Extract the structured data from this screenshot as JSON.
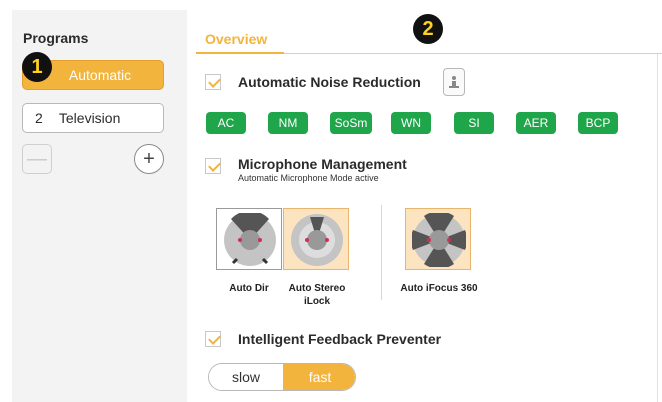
{
  "sidebar": {
    "title": "Programs",
    "programs": [
      {
        "number": "",
        "name": "Automatic",
        "active": true
      },
      {
        "number": "2",
        "name": "Television",
        "active": false
      }
    ],
    "remove_symbol": "—",
    "add_symbol": "+"
  },
  "badges": [
    "1",
    "2"
  ],
  "tabs": [
    {
      "label": "Overview",
      "active": true
    }
  ],
  "sections": {
    "noise": {
      "label": "Automatic Noise Reduction",
      "checked": true,
      "pills": [
        "AC",
        "NM",
        "SoSm",
        "WN",
        "SI",
        "AER",
        "BCP"
      ],
      "pill_color": "#1fa54a"
    },
    "microphone": {
      "label": "Microphone Management",
      "subtitle": "Automatic Microphone Mode active",
      "checked": true,
      "modes": [
        {
          "label_line1": "Auto Dir",
          "label_line2": "",
          "selected": false
        },
        {
          "label_line1": "Auto Stereo",
          "label_line2": "iLock",
          "selected": true
        },
        {
          "label_line1": "Auto iFocus 360",
          "label_line2": "",
          "selected": true
        }
      ]
    },
    "feedback": {
      "label": "Intelligent Feedback Preventer",
      "checked": true,
      "speed_options": [
        "slow",
        "fast"
      ],
      "selected_speed": "fast"
    }
  },
  "colors": {
    "accent": "#f2b43d",
    "green": "#1fa54a",
    "badge_bg": "#111111",
    "badge_fg": "#ffd21f"
  }
}
